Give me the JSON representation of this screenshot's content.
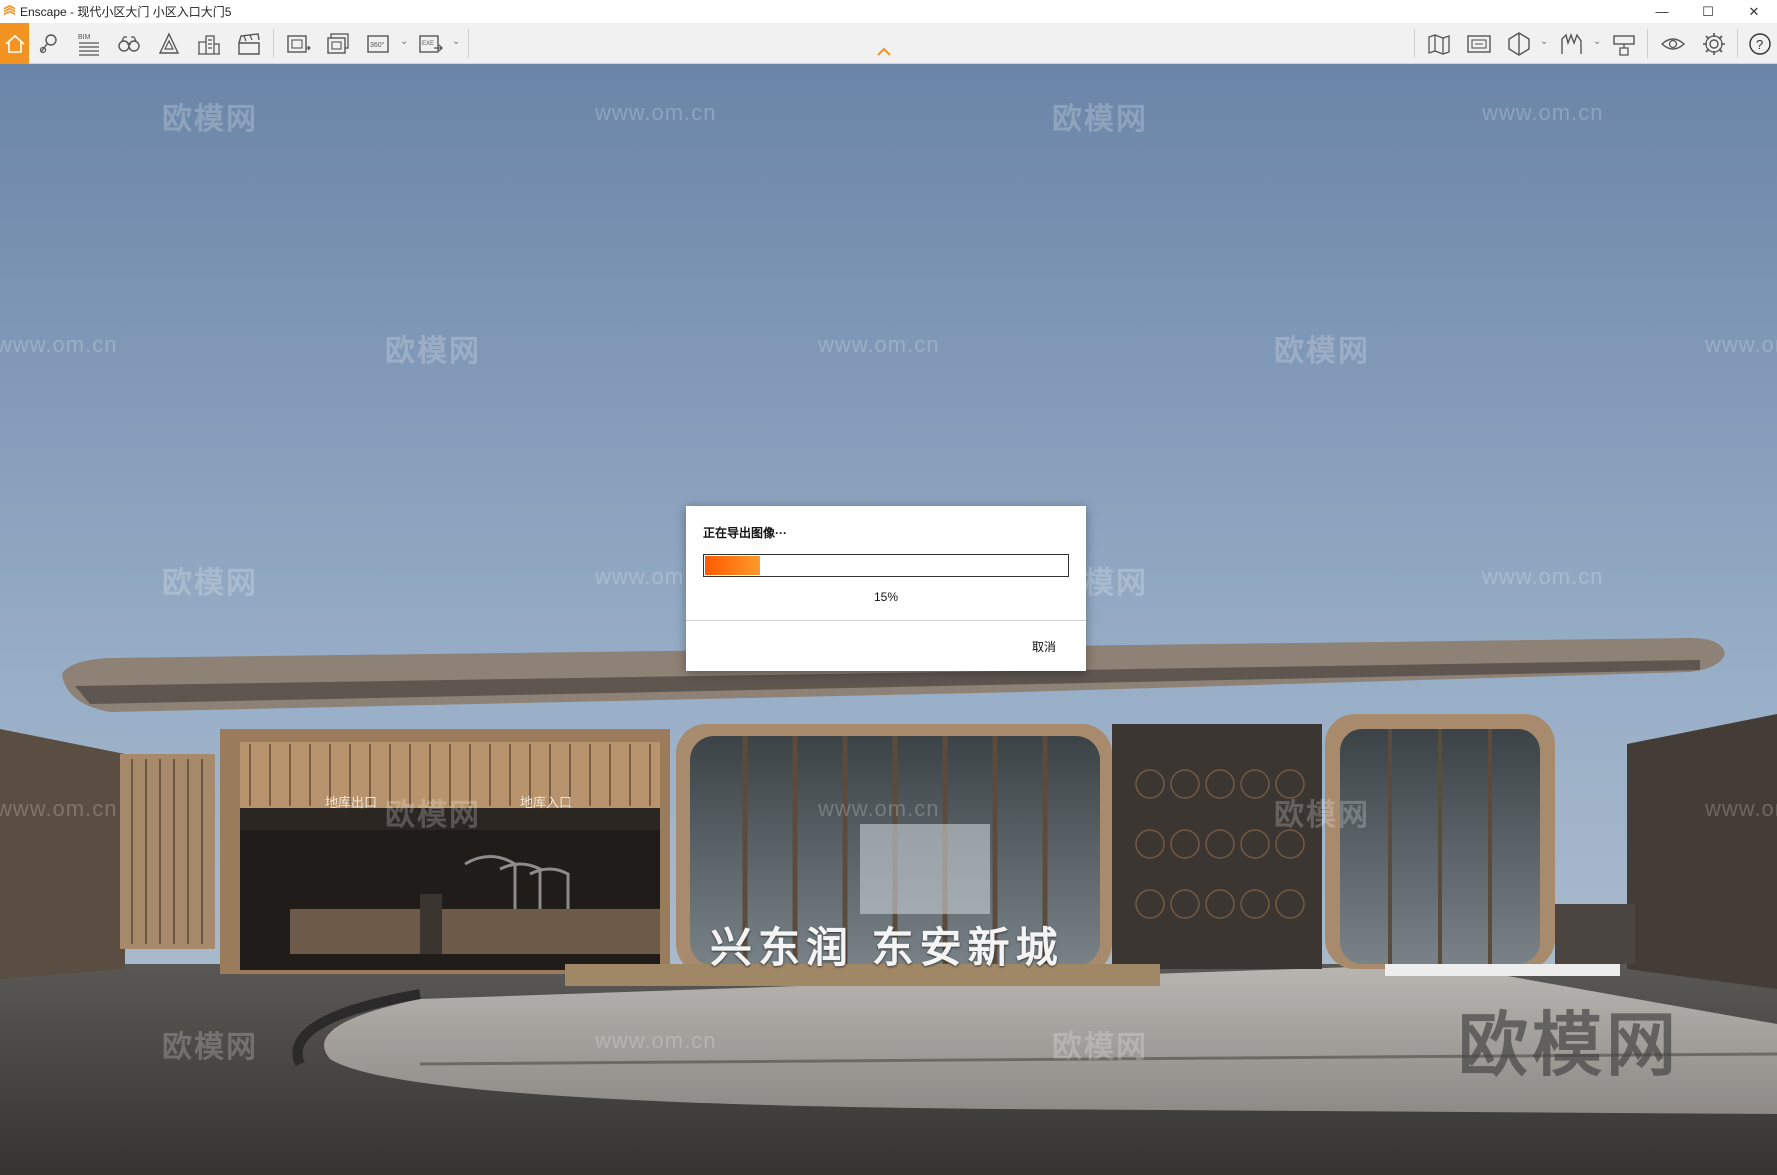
{
  "window": {
    "title": "Enscape - 现代小区大门 小区入口大门5",
    "minimize": "—",
    "maximize": "☐",
    "close": "✕"
  },
  "toolbar": {
    "left_icons": [
      "home-icon",
      "map-pin-icon",
      "bim-icon",
      "binoculars-icon",
      "navigation-icon",
      "buildings-icon",
      "clapperboard-icon",
      "screenshot-icon",
      "batch-render-icon",
      "panorama-360-icon",
      "export-exe-icon"
    ],
    "bim_label": "BIM",
    "pano_label": "360°",
    "exe_label": "EXE",
    "right_icons": [
      "map-icon",
      "view-manager-icon",
      "section-icon",
      "asset-library-icon",
      "material-editor-icon",
      "visual-settings-icon",
      "settings-icon",
      "help-icon"
    ],
    "help_label": "?",
    "accent_color": "#f39322"
  },
  "viewport": {
    "watermarks": [
      "欧模网",
      "www.om.cn"
    ],
    "watermark_corner": "欧模网",
    "sign_text": "兴东润 东安新城",
    "gate_labels": [
      "地库出口",
      "地库入口"
    ]
  },
  "dialog": {
    "title": "正在导出图像···",
    "progress_percent": 15,
    "progress_text": "15%",
    "cancel_label": "取消"
  }
}
